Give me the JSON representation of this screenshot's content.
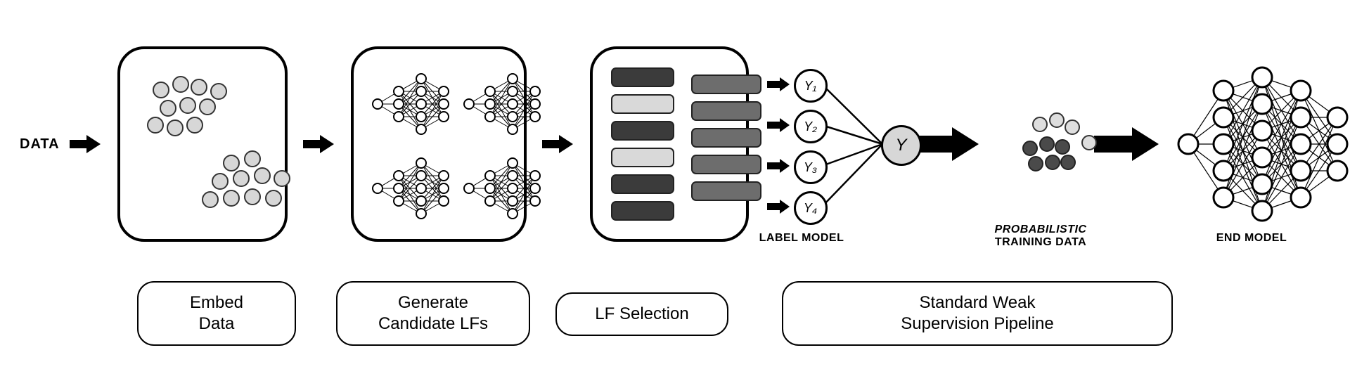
{
  "labels": {
    "data": "DATA",
    "label_model": "LABEL MODEL",
    "prob_training_data_line1": "PROBABILISTIC",
    "prob_training_data_line2": "TRAINING DATA",
    "end_model": "END MODEL"
  },
  "stages": {
    "embed": "Embed\nData",
    "generate": "Generate\nCandidate LFs",
    "select": "LF Selection",
    "weak": "Standard Weak\nSupervision Pipeline"
  },
  "label_model_nodes": [
    "Y₁",
    "Y₂",
    "Y₃",
    "Y₄"
  ],
  "label_model_output": "Y"
}
